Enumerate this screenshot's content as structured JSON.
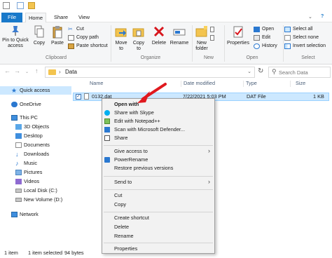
{
  "ribbon_tabs": {
    "file": "File",
    "home": "Home",
    "share": "Share",
    "view": "View"
  },
  "ribbon": {
    "clipboard": {
      "pin": "Pin to Quick access",
      "copy": "Copy",
      "paste": "Paste",
      "cut": "Cut",
      "copy_path": "Copy path",
      "paste_shortcut": "Paste shortcut",
      "label": "Clipboard"
    },
    "organize": {
      "move_to": "Move to",
      "copy_to": "Copy to",
      "delete": "Delete",
      "rename": "Rename",
      "label": "Organize"
    },
    "new": {
      "new_folder": "New folder",
      "label": "New"
    },
    "open": {
      "properties": "Properties",
      "open": "Open",
      "edit": "Edit",
      "history": "History",
      "label": "Open"
    },
    "select": {
      "select_all": "Select all",
      "select_none": "Select none",
      "invert": "Invert selection",
      "label": "Select"
    }
  },
  "address": {
    "crumb": "Data",
    "search_placeholder": "Search Data"
  },
  "nav": {
    "items": [
      "Quick access",
      "OneDrive",
      "This PC",
      "3D Objects",
      "Desktop",
      "Documents",
      "Downloads",
      "Music",
      "Pictures",
      "Videos",
      "Local Disk (C:)",
      "New Volume (D:)",
      "Network"
    ]
  },
  "columns": {
    "name": "Name",
    "date_modified": "Date modified",
    "type": "Type",
    "size": "Size"
  },
  "file": {
    "name": "0132.dat",
    "date": "7/22/2021 5:03 PM",
    "type": "DAT File",
    "size": "1 KB"
  },
  "status": {
    "items": "1 item",
    "selected": "1 item selected",
    "bytes": "94 bytes"
  },
  "context_menu": {
    "open_with": "Open with",
    "share_skype": "Share with Skype",
    "edit_notepad": "Edit with Notepad++",
    "scan_defender": "Scan with Microsoft Defender...",
    "share": "Share",
    "give_access": "Give access to",
    "power_rename": "PowerRename",
    "restore_versions": "Restore previous versions",
    "send_to": "Send to",
    "cut": "Cut",
    "copy": "Copy",
    "create_shortcut": "Create shortcut",
    "delete": "Delete",
    "rename": "Rename",
    "properties": "Properties"
  },
  "colors": {
    "file_tab": "#1979ca",
    "selection": "#cce8ff",
    "annotation_arrow": "#e0191f"
  },
  "icons": [
    "back-arrow-icon",
    "forward-arrow-icon",
    "up-arrow-icon",
    "folder-icon",
    "refresh-icon",
    "search-icon",
    "star-icon",
    "cloud-icon",
    "pc-icon",
    "drive-icon",
    "network-icon",
    "skype-icon",
    "notepad-icon",
    "defender-icon",
    "share-icon",
    "chevron-right-icon",
    "delete-x-icon"
  ]
}
